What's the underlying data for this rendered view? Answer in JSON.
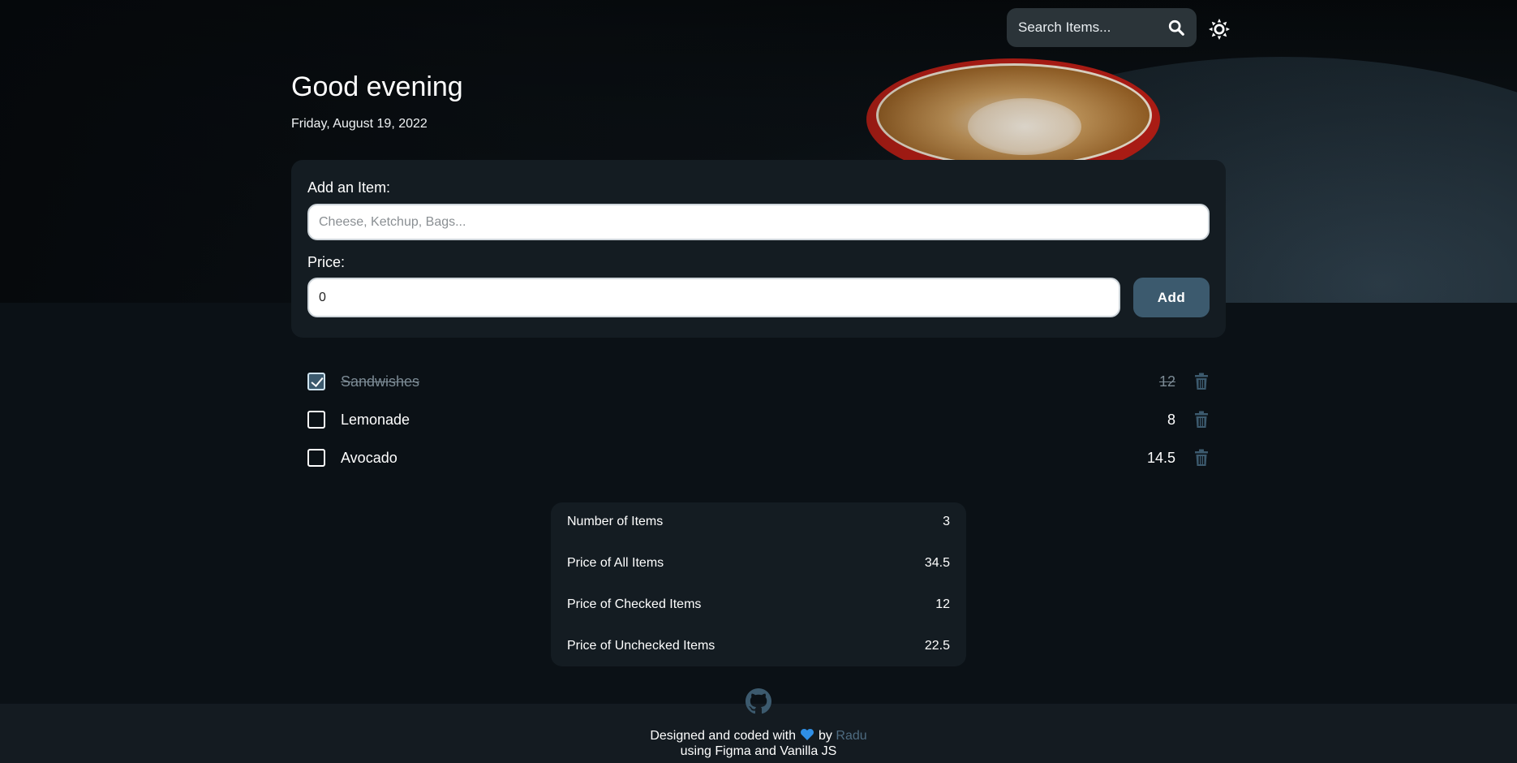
{
  "header": {
    "search_placeholder": "Search Items...",
    "search_icon": "magnifier-icon",
    "theme_icon": "sun-icon"
  },
  "greeting": {
    "title": "Good evening",
    "date": "Friday, August 19, 2022"
  },
  "form": {
    "item_label": "Add an Item:",
    "item_placeholder": "Cheese, Ketchup, Bags...",
    "price_label": "Price:",
    "price_value": "0",
    "add_label": "Add"
  },
  "items": [
    {
      "name": "Sandwishes",
      "price": "12",
      "checked": true
    },
    {
      "name": "Lemonade",
      "price": "8",
      "checked": false
    },
    {
      "name": "Avocado",
      "price": "14.5",
      "checked": false
    }
  ],
  "summary": [
    {
      "label": "Number of Items",
      "value": "3"
    },
    {
      "label": "Price of All Items",
      "value": "34.5"
    },
    {
      "label": "Price of Checked Items",
      "value": "12"
    },
    {
      "label": "Price of Unchecked Items",
      "value": "22.5"
    }
  ],
  "footer": {
    "line1_prefix": "Designed and coded with",
    "line1_by": "by",
    "author": "Radu",
    "line2": "using Figma and Vanilla JS"
  },
  "colors": {
    "accent": "#3c5a6e",
    "heart": "#2f8fe6",
    "link": "#4e6b80",
    "background": "#0b1116",
    "card": "#141c22"
  }
}
